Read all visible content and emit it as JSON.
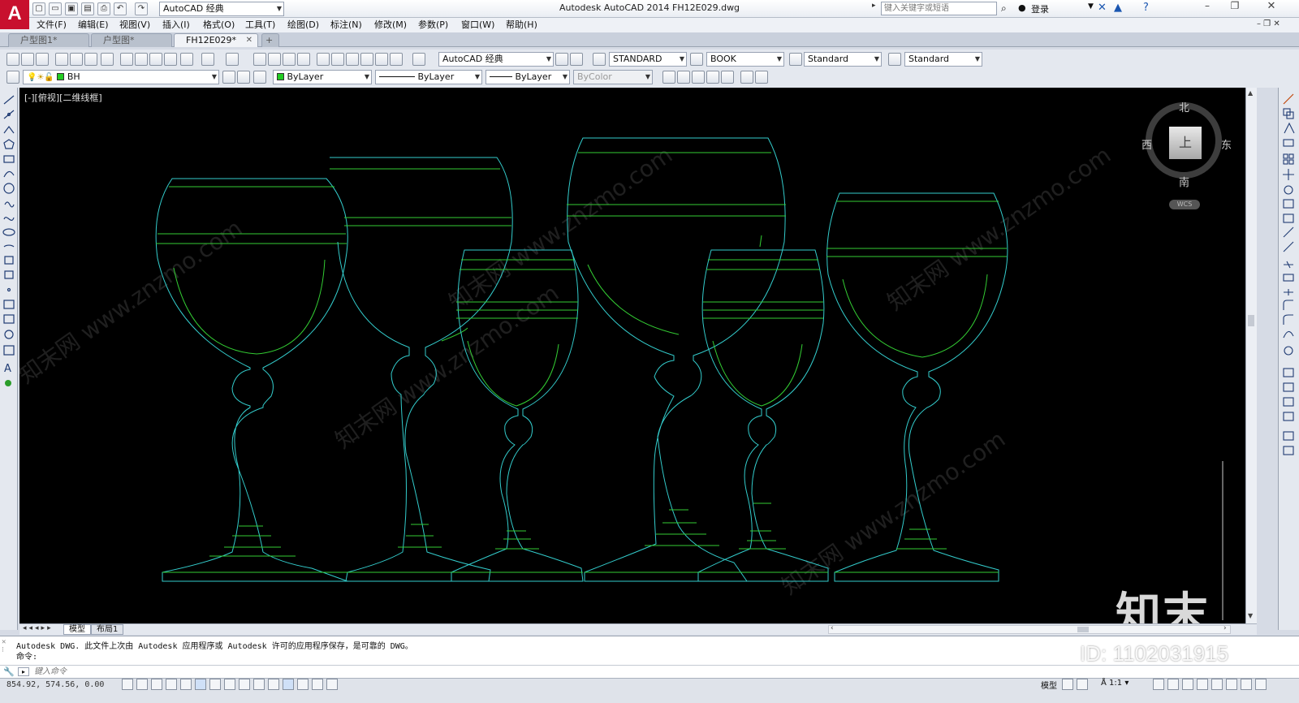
{
  "title_bar": {
    "workspace": "AutoCAD 经典",
    "app_title": "Autodesk AutoCAD 2014    FH12E029.dwg",
    "search_placeholder": "键入关键字或短语",
    "login_label": "登录"
  },
  "menu": [
    "文件(F)",
    "编辑(E)",
    "视图(V)",
    "插入(I)",
    "格式(O)",
    "工具(T)",
    "绘图(D)",
    "标注(N)",
    "修改(M)",
    "参数(P)",
    "窗口(W)",
    "帮助(H)"
  ],
  "file_tabs": [
    {
      "label": "户型图1*"
    },
    {
      "label": "户型图*"
    },
    {
      "label": "FH12E029*"
    }
  ],
  "toolbar1": {
    "workspace_combo": "AutoCAD 经典",
    "text_style": "STANDARD",
    "dim_style": "BOOK",
    "table_style": "Standard",
    "mleader_style": "Standard"
  },
  "toolbar2": {
    "layer": "BH",
    "color": "ByLayer",
    "linetype": "ByLayer",
    "lineweight": "ByLayer",
    "plotstyle": "ByColor"
  },
  "viewport": {
    "label": "[-][俯视][二维线框]",
    "viewcube": {
      "north": "北",
      "south": "南",
      "east": "东",
      "west": "西",
      "face": "上",
      "wcs": "WCS"
    },
    "watermark_logo": "知末",
    "watermark_id": "ID: 1102031915",
    "watermark_text": "知末网 www.znzmo.com"
  },
  "layout_tabs": [
    "模型",
    "布局1"
  ],
  "command": {
    "history_line": "Autodesk DWG.  此文件上次由 Autodesk 应用程序或 Autodesk 许可的应用程序保存，是可靠的 DWG。",
    "prompt": "命令:",
    "input_placeholder": "键入命令"
  },
  "status": {
    "coordinates": "854.92, 574.56, 0.00",
    "model_label": "模型",
    "scale": "1:1"
  },
  "colors": {
    "glass_outline": "#33cccc",
    "glass_band": "#33cc33",
    "canvas": "#000000",
    "logo": "#c8102e"
  }
}
